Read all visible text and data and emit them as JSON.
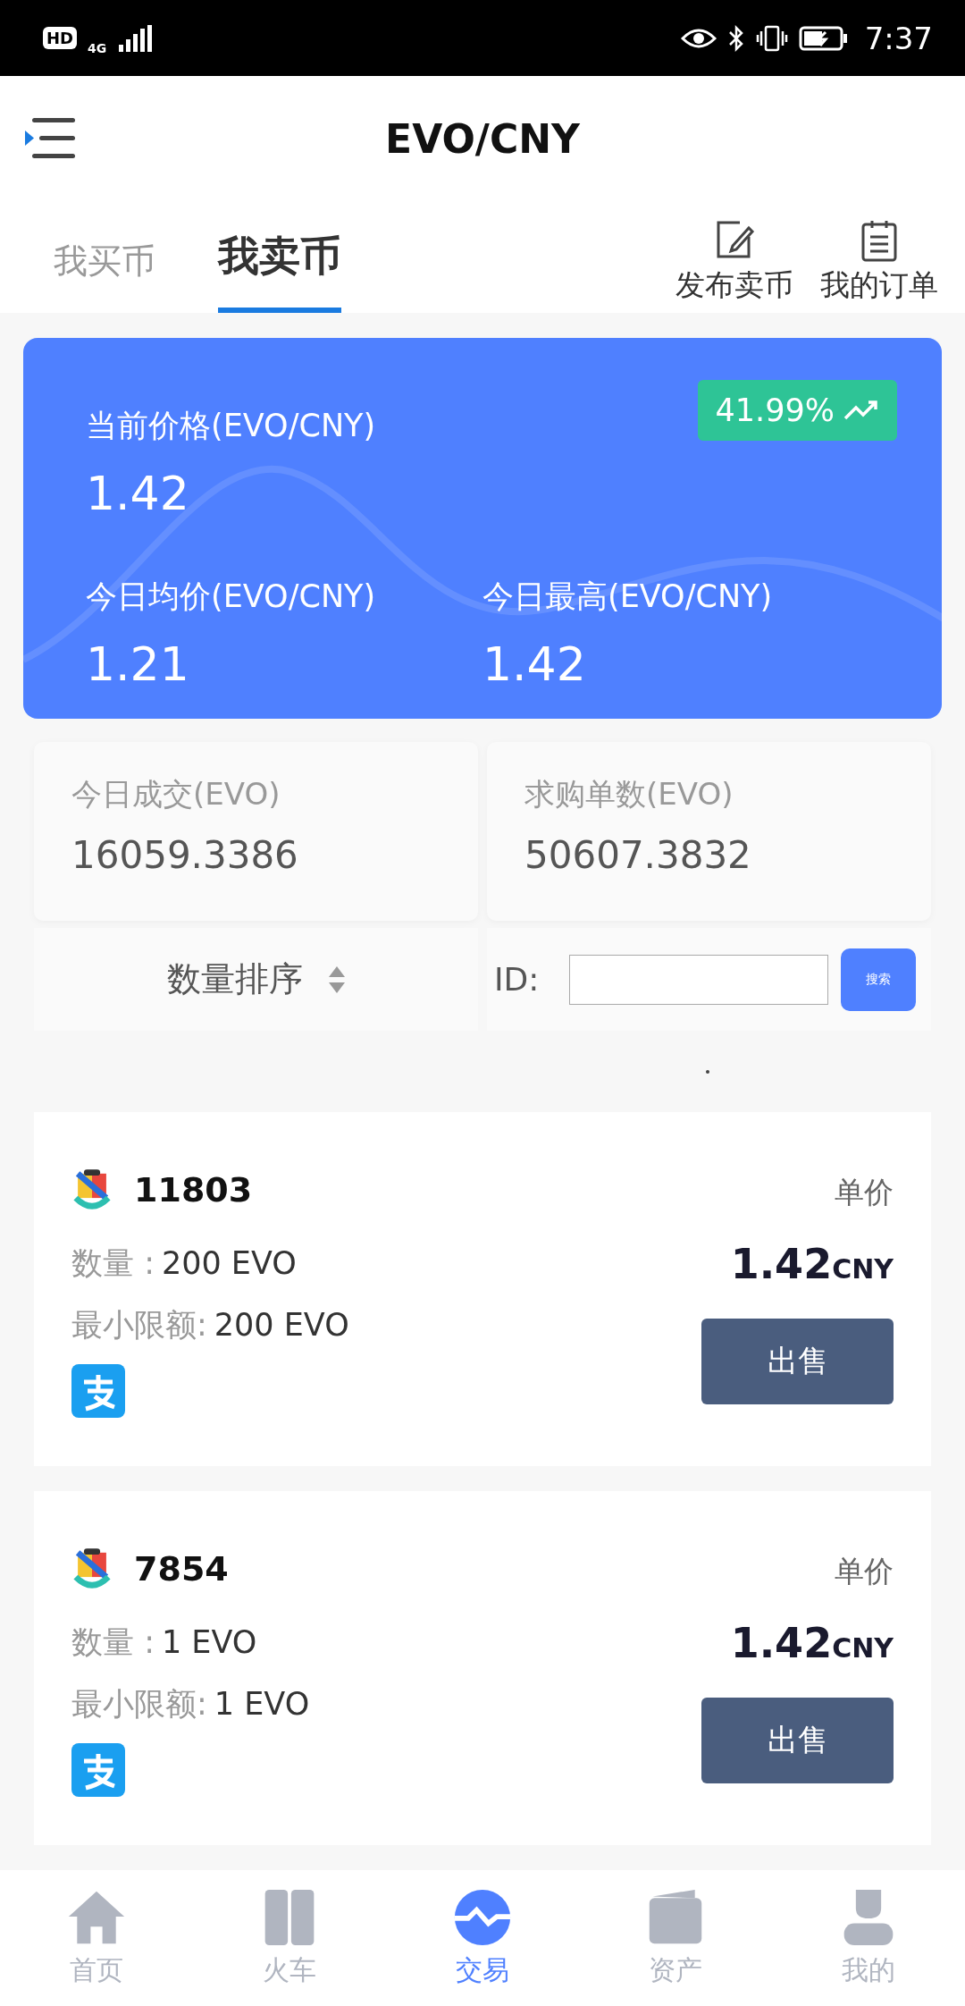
{
  "status_bar": {
    "badge": "HD",
    "network": "4G",
    "time": "7:37"
  },
  "header": {
    "title": "EVO/CNY"
  },
  "tabs": [
    {
      "label": "我买币",
      "selected": false
    },
    {
      "label": "我卖币",
      "selected": true
    }
  ],
  "actions": [
    {
      "label": "发布卖币",
      "kind": "publish"
    },
    {
      "label": "我的订单",
      "kind": "orders"
    }
  ],
  "price_card": {
    "current_label": "当前价格(EVO/CNY)",
    "current_value": "1.42",
    "change": "41.99%",
    "rising": true,
    "stats": [
      {
        "label": "今日均价(EVO/CNY)",
        "value": "1.21"
      },
      {
        "label": "今日最高(EVO/CNY)",
        "value": "1.42"
      }
    ]
  },
  "summary": [
    {
      "label": "今日成交(EVO)",
      "value": "16059.3386"
    },
    {
      "label": "求购单数(EVO)",
      "value": "50607.3832"
    }
  ],
  "filter": {
    "sort_label": "数量排序",
    "id_label": "ID:",
    "search_button": "搜索"
  },
  "orders": [
    {
      "user": "11803",
      "quantity_label": "数量 :",
      "quantity": "200 EVO",
      "min_label": "最小限额:",
      "min": "200 EVO",
      "price_label": "单价",
      "price": "1.42",
      "currency": "CNY",
      "action": "出售"
    },
    {
      "user": "7854",
      "quantity_label": "数量 :",
      "quantity": "1 EVO",
      "min_label": "最小限额:",
      "min": "1 EVO",
      "price_label": "单价",
      "price": "1.42",
      "currency": "CNY",
      "action": "出售"
    }
  ],
  "nav": [
    {
      "label": "首页",
      "kind": "home",
      "selected": false
    },
    {
      "label": "火车",
      "kind": "train",
      "selected": false
    },
    {
      "label": "交易",
      "kind": "trade",
      "selected": true
    },
    {
      "label": "资产",
      "kind": "wallet",
      "selected": false
    },
    {
      "label": "我的",
      "kind": "profile",
      "selected": false
    }
  ]
}
